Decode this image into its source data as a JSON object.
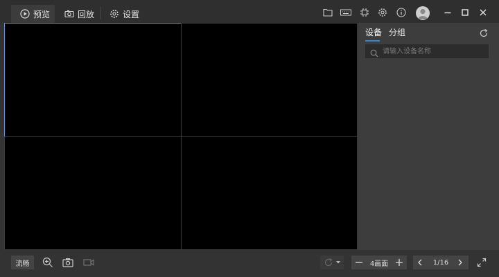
{
  "header": {
    "tabs": [
      {
        "label": "预览",
        "icon": "play-circle-icon",
        "active": true
      },
      {
        "label": "回放",
        "icon": "camera-playback-icon",
        "active": false
      },
      {
        "label": "设置",
        "icon": "gear-icon",
        "active": false
      }
    ],
    "toolbar_icons": [
      "folder-icon",
      "keyboard-icon",
      "chip-icon",
      "gear-icon",
      "info-icon",
      "avatar",
      "minimize-icon",
      "maximize-icon",
      "close-icon"
    ]
  },
  "sidebar": {
    "tabs": [
      {
        "label": "设备",
        "active": true
      },
      {
        "label": "分组",
        "active": false
      }
    ],
    "search_placeholder": "请输入设备名称"
  },
  "grid": {
    "layout": "2x2",
    "selected_cell": 1
  },
  "bottom": {
    "smooth_label": "流畅",
    "layout_label": "4画面",
    "page": "1/16"
  },
  "colors": {
    "accent": "#2f86d6",
    "selection": "#5b8fd6",
    "background": "#333333"
  }
}
